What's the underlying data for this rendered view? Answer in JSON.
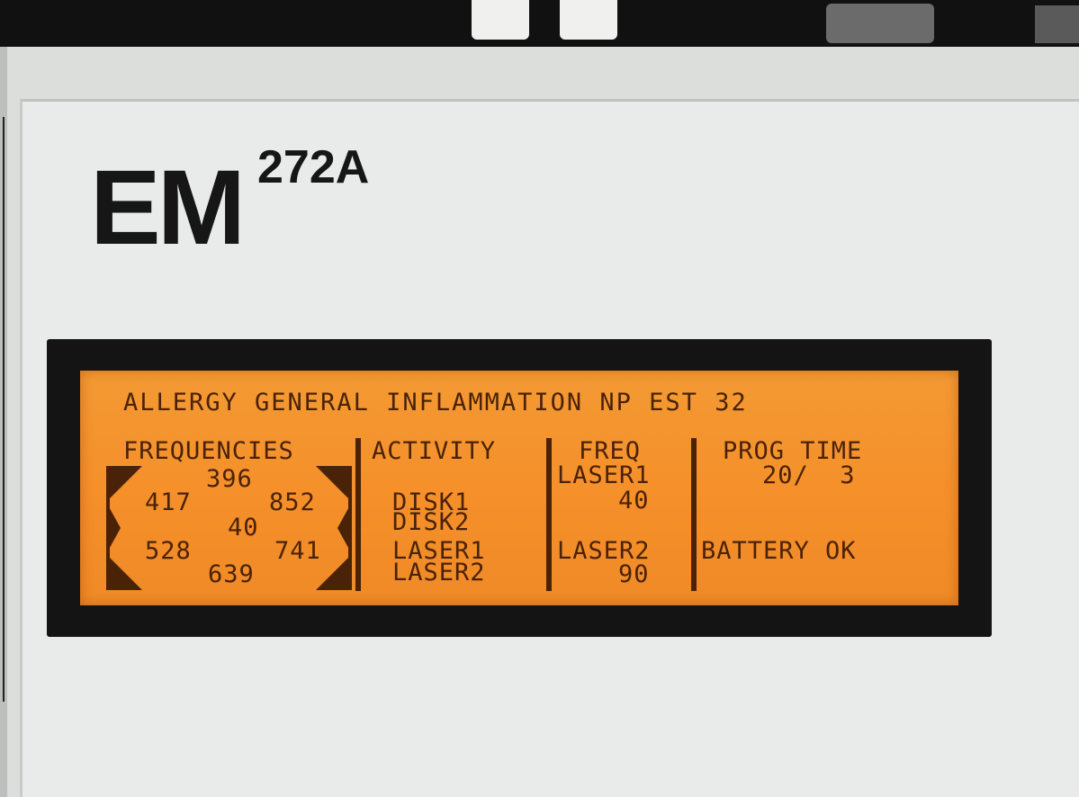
{
  "device": {
    "brand": "EM",
    "model": "272A"
  },
  "lcd": {
    "title": "ALLERGY GENERAL INFLAMMATION NP EST 32",
    "headers": {
      "frequencies": "FREQUENCIES",
      "activity": "ACTIVITY",
      "freq": "FREQ",
      "prog_time": "PROG TIME"
    },
    "frequencies": {
      "top": "396",
      "upper_left": "417",
      "upper_right": "852",
      "center": "40",
      "lower_left": "528",
      "lower_right": "741",
      "bottom": "639"
    },
    "activity": [
      "DISK1",
      "DISK2",
      "LASER1",
      "LASER2"
    ],
    "freq": {
      "laser1_label": "LASER1",
      "laser1_value": "40",
      "laser2_label": "LASER2",
      "laser2_value": "90"
    },
    "prog_time": {
      "value": "20/  3"
    },
    "status": "BATTERY OK"
  },
  "colors": {
    "lcd_background": "#f39a33",
    "lcd_text": "#4a2208",
    "bezel": "#141414",
    "panel": "#e9ebea",
    "brand_text": "#161616"
  }
}
